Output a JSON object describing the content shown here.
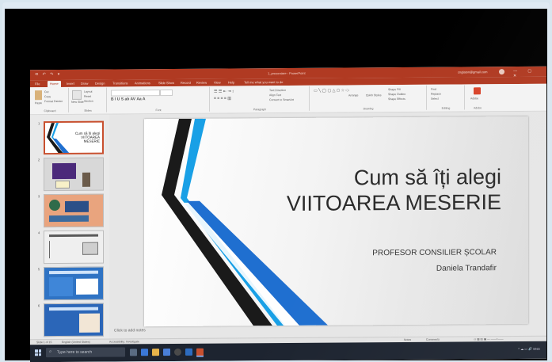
{
  "titlebar": {
    "doc_title": "1_prezentare - PowerPoint",
    "user_email": "cnglaton@gmail.com",
    "quick_access": "⟲ ↶ ↷ ▾"
  },
  "ribbon_tabs": [
    "File",
    "Home",
    "Insert",
    "Draw",
    "Design",
    "Transitions",
    "Animations",
    "Slide Show",
    "Record",
    "Review",
    "View",
    "Help",
    "Tell me what you want to do"
  ],
  "ribbon_groups": {
    "clipboard": "Clipboard",
    "slides": "Slides",
    "font": "Font",
    "paragraph": "Paragraph",
    "drawing": "Drawing",
    "editing": "Editing",
    "adobe": "Adobe"
  },
  "ribbon_buttons": {
    "paste": "Paste",
    "cut": "Cut",
    "copy": "Copy",
    "format_painter": "Format Painter",
    "new_slide": "New Slide",
    "layout": "Layout",
    "reset": "Reset",
    "section": "Section",
    "arrange": "Arrange",
    "quick_styles": "Quick Styles",
    "find": "Find",
    "replace": "Replace",
    "select": "Select",
    "shape_fill": "Shape Fill",
    "shape_outline": "Shape Outline",
    "shape_effects": "Shape Effects",
    "text_direction": "Text Direction",
    "align_text": "Align Text",
    "convert_smartart": "Convert to SmartArt",
    "adobe_btn": "Adobe"
  },
  "thumbnails": [
    {
      "num": "1",
      "title": "Cum să îți alegi VIITOAREA MESERIE"
    },
    {
      "num": "2",
      "title": ""
    },
    {
      "num": "3",
      "title": ""
    },
    {
      "num": "4",
      "title": ""
    },
    {
      "num": "5",
      "title": ""
    },
    {
      "num": "6",
      "title": ""
    }
  ],
  "slide": {
    "title_line1": "Cum să îți alegi",
    "title_line2": "VIITOAREA MESERIE",
    "subtitle_line1": "PROFESOR CONSILIER ȘCOLAR",
    "subtitle_line2": "Daniela Trandafir",
    "notes_placeholder": "Click to add notes"
  },
  "statusbar": {
    "slide_info": "Slide 1 of 15",
    "language": "English (United States)",
    "accessibility": "Accessibility: Investigate",
    "notes": "Notes",
    "comments": "Comments"
  },
  "taskbar": {
    "search_placeholder": "Type here to search"
  },
  "colors": {
    "accent_powerpoint": "#b03a22",
    "slide_blue": "#1f6fd0",
    "slide_light_blue": "#19a0e6",
    "slide_black": "#1a1a1a"
  }
}
